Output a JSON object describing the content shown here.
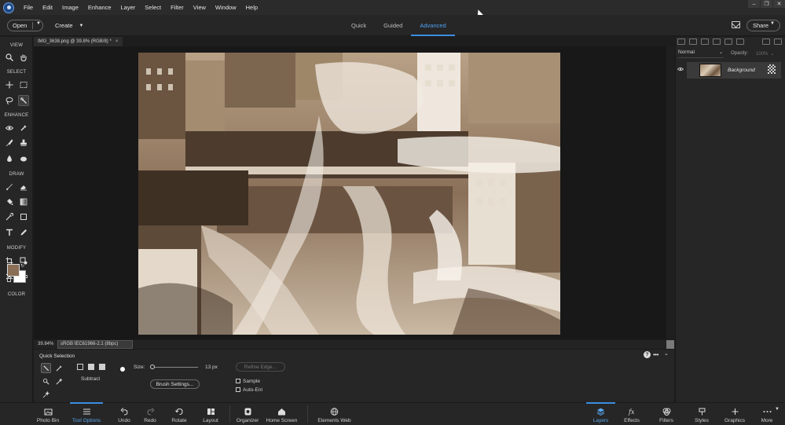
{
  "menu": [
    "File",
    "Edit",
    "Image",
    "Enhance",
    "Layer",
    "Select",
    "Filter",
    "View",
    "Window",
    "Help"
  ],
  "header": {
    "open_label": "Open",
    "create_label": "Create",
    "modes": [
      "Quick",
      "Guided",
      "Advanced"
    ],
    "active_mode": "Advanced",
    "share_label": "Share"
  },
  "toolbox": {
    "sections": [
      "VIEW",
      "SELECT",
      "ENHANCE",
      "DRAW",
      "MODIFY",
      "COLOR"
    ]
  },
  "document": {
    "tab_title": "IMG_3638.png @ 39.8% (RGB/8) *",
    "zoom": "39.84%",
    "color_profile": "sRGB IEC61966-2.1 (8bpc)"
  },
  "tool_options": {
    "title": "Quick Selection",
    "mode_label": "Subtract",
    "size_label": "Size:",
    "size_value": "13 px",
    "refine_edge": "Refine Edge...",
    "brush_settings": "Brush Settings...",
    "sample_label": "Sample",
    "auto_enhance_label": "Auto-Enl"
  },
  "layers": {
    "blend_mode": "Normal",
    "opacity_label": "Opacity:",
    "opacity_value": "100%",
    "items": [
      {
        "name": "Background"
      }
    ]
  },
  "bottom_bar": {
    "left": [
      "Photo Bin",
      "Tool Options",
      "Undo",
      "Redo",
      "Rotate",
      "Layout",
      "Organizer",
      "Home Screen",
      "Elements Web"
    ],
    "right": [
      "Layers",
      "Effects",
      "Filters",
      "Styles",
      "Graphics",
      "More"
    ]
  },
  "colors": {
    "accent": "#3b8de0",
    "foreground": "#8a6e55",
    "background": "#ffffff"
  }
}
